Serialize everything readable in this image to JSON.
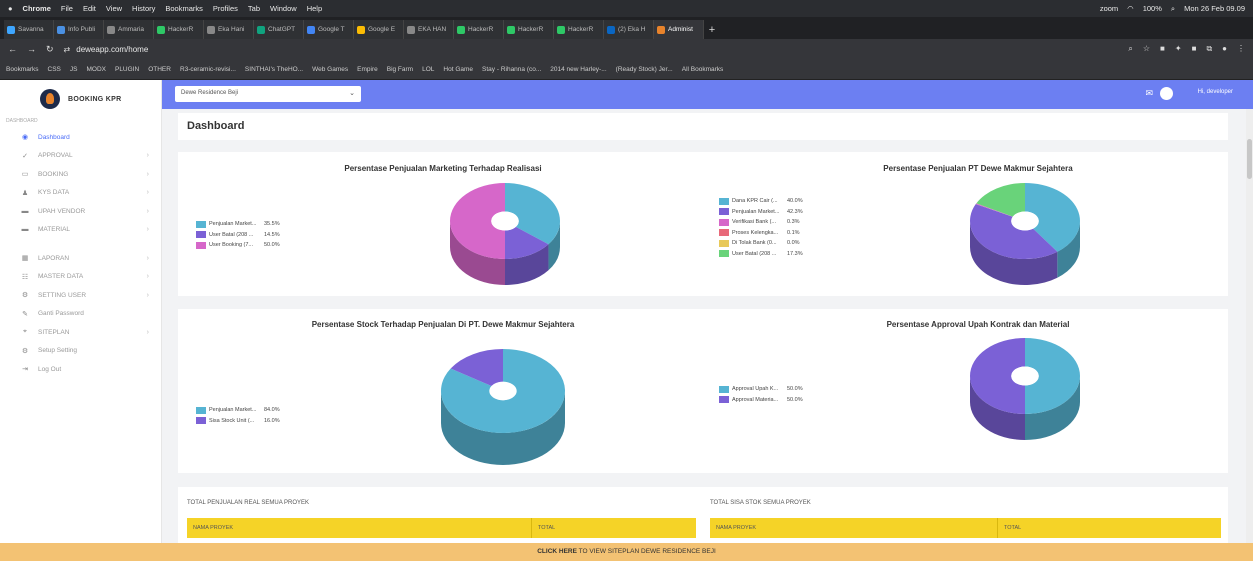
{
  "os_menubar": {
    "apple": "",
    "items": [
      "Chrome",
      "File",
      "Edit",
      "View",
      "History",
      "Bookmarks",
      "Profiles",
      "Tab",
      "Window",
      "Help"
    ],
    "zoom_label": "zoom",
    "battery": "100%",
    "datetime": "Mon 26 Feb 09.09"
  },
  "browser": {
    "tabs": [
      {
        "label": "Savanna",
        "color": "#3ea6ff"
      },
      {
        "label": "Info Publi",
        "color": "#4a90e2"
      },
      {
        "label": "Ammaria",
        "color": "#888888"
      },
      {
        "label": "HackerR",
        "color": "#2ec866"
      },
      {
        "label": "Eka Hani",
        "color": "#888888"
      },
      {
        "label": "ChatGPT",
        "color": "#10a37f"
      },
      {
        "label": "Google T",
        "color": "#4285f4"
      },
      {
        "label": "Google E",
        "color": "#fbbc04"
      },
      {
        "label": "EKA HAN",
        "color": "#888888"
      },
      {
        "label": "HackerR",
        "color": "#2ec866"
      },
      {
        "label": "HackerR",
        "color": "#2ec866"
      },
      {
        "label": "HackerR",
        "color": "#2ec866"
      },
      {
        "label": "(2) Eka H",
        "color": "#0a66c2"
      },
      {
        "label": "Administ",
        "color": "#e8832b"
      }
    ],
    "new_tab": "+",
    "url": "deweapp.com/home",
    "bookmarks": [
      "Bookmarks",
      "CSS",
      "JS",
      "MODX",
      "PLUGIN",
      "OTHER",
      "R3-ceramic-revisi...",
      "SINTHAI's TheHO...",
      "Web Games",
      "Empire",
      "Big Farm",
      "LOL",
      "Hot Game",
      "Stay - Rihanna (co...",
      "2014 new Harley-...",
      "(Ready Stock) Jer...",
      "All Bookmarks"
    ]
  },
  "sidebar": {
    "brand": "BOOKING KPR",
    "section_label": "DASHBOARD",
    "items": [
      {
        "icon": "◉",
        "label": "Dashboard"
      },
      {
        "icon": "✓",
        "label": "APPROVAL"
      },
      {
        "icon": "▭",
        "label": "BOOKING"
      },
      {
        "icon": "♟",
        "label": "KYS DATA"
      },
      {
        "icon": "▬",
        "label": "UPAH VENDOR"
      },
      {
        "icon": "▬",
        "label": "MATERIAL"
      },
      {
        "icon": "▦",
        "label": "LAPORAN"
      },
      {
        "icon": "☷",
        "label": "MASTER DATA"
      },
      {
        "icon": "⚙",
        "label": "SETTING USER"
      },
      {
        "icon": "✎",
        "label": "Ganti Password"
      },
      {
        "icon": "⌖",
        "label": "SITEPLAN"
      },
      {
        "icon": "⚙",
        "label": "Setup Setting"
      },
      {
        "icon": "⇥",
        "label": "Log Out"
      }
    ]
  },
  "topbar": {
    "project_select": "Dewe Residence Beji",
    "user_name": "Hi, developer"
  },
  "page": {
    "title": "Dashboard"
  },
  "chart_data": [
    {
      "type": "pie",
      "title": "Persentase Penjualan Marketing Terhadap Realisasi",
      "legend": [
        {
          "label": "Penjualan Market...",
          "value": "35.5%",
          "color": "#56b4d3"
        },
        {
          "label": "User Batal (208 ...",
          "value": "14.5%",
          "color": "#7b61d6"
        },
        {
          "label": "User Booking (7...",
          "value": "50.0%",
          "color": "#d667c9"
        }
      ],
      "values": [
        35.5,
        14.5,
        50.0
      ]
    },
    {
      "type": "pie",
      "title": "Persentase Penjualan PT Dewe Makmur Sejahtera",
      "legend": [
        {
          "label": "Dana KPR Cair (...",
          "value": "40.0%",
          "color": "#56b4d3"
        },
        {
          "label": "Penjualan Market...",
          "value": "42.3%",
          "color": "#7b61d6"
        },
        {
          "label": "Verifikasi Bank (...",
          "value": "0.3%",
          "color": "#d667c9"
        },
        {
          "label": "Proses Kelengka...",
          "value": "0.1%",
          "color": "#e8697a"
        },
        {
          "label": "Di Tolak Bank (0...",
          "value": "0.0%",
          "color": "#e8c95a"
        },
        {
          "label": "User Batal (208 ...",
          "value": "17.3%",
          "color": "#69d37a"
        }
      ],
      "values": [
        40.0,
        42.3,
        0.3,
        0.1,
        0.0,
        17.3
      ]
    },
    {
      "type": "pie",
      "title": "Persentase Stock Terhadap Penjualan Di PT. Dewe Makmur Sejahtera",
      "legend": [
        {
          "label": "Penjualan Market...",
          "value": "84.0%",
          "color": "#56b4d3"
        },
        {
          "label": "Sisa Stock Unit (...",
          "value": "16.0%",
          "color": "#7b61d6"
        }
      ],
      "values": [
        84.0,
        16.0
      ]
    },
    {
      "type": "pie",
      "title": "Persentase Approval Upah Kontrak dan Material",
      "legend": [
        {
          "label": "Approval Upah K...",
          "value": "50.0%",
          "color": "#56b4d3"
        },
        {
          "label": "Approval Materia...",
          "value": "50.0%",
          "color": "#7b61d6"
        }
      ],
      "values": [
        50.0,
        50.0
      ]
    }
  ],
  "tables": {
    "left": {
      "title": "TOTAL PENJUALAN REAL SEMUA PROYEK",
      "col1": "NAMA PROYEK",
      "col2": "TOTAL"
    },
    "right": {
      "title": "TOTAL SISA STOK SEMUA PROYEK",
      "col1": "NAMA PROYEK",
      "col2": "TOTAL"
    }
  },
  "banner": {
    "strong": "CLICK HERE",
    "text": " TO VIEW SITEPLAN DEWE RESIDENCE BEJI"
  }
}
